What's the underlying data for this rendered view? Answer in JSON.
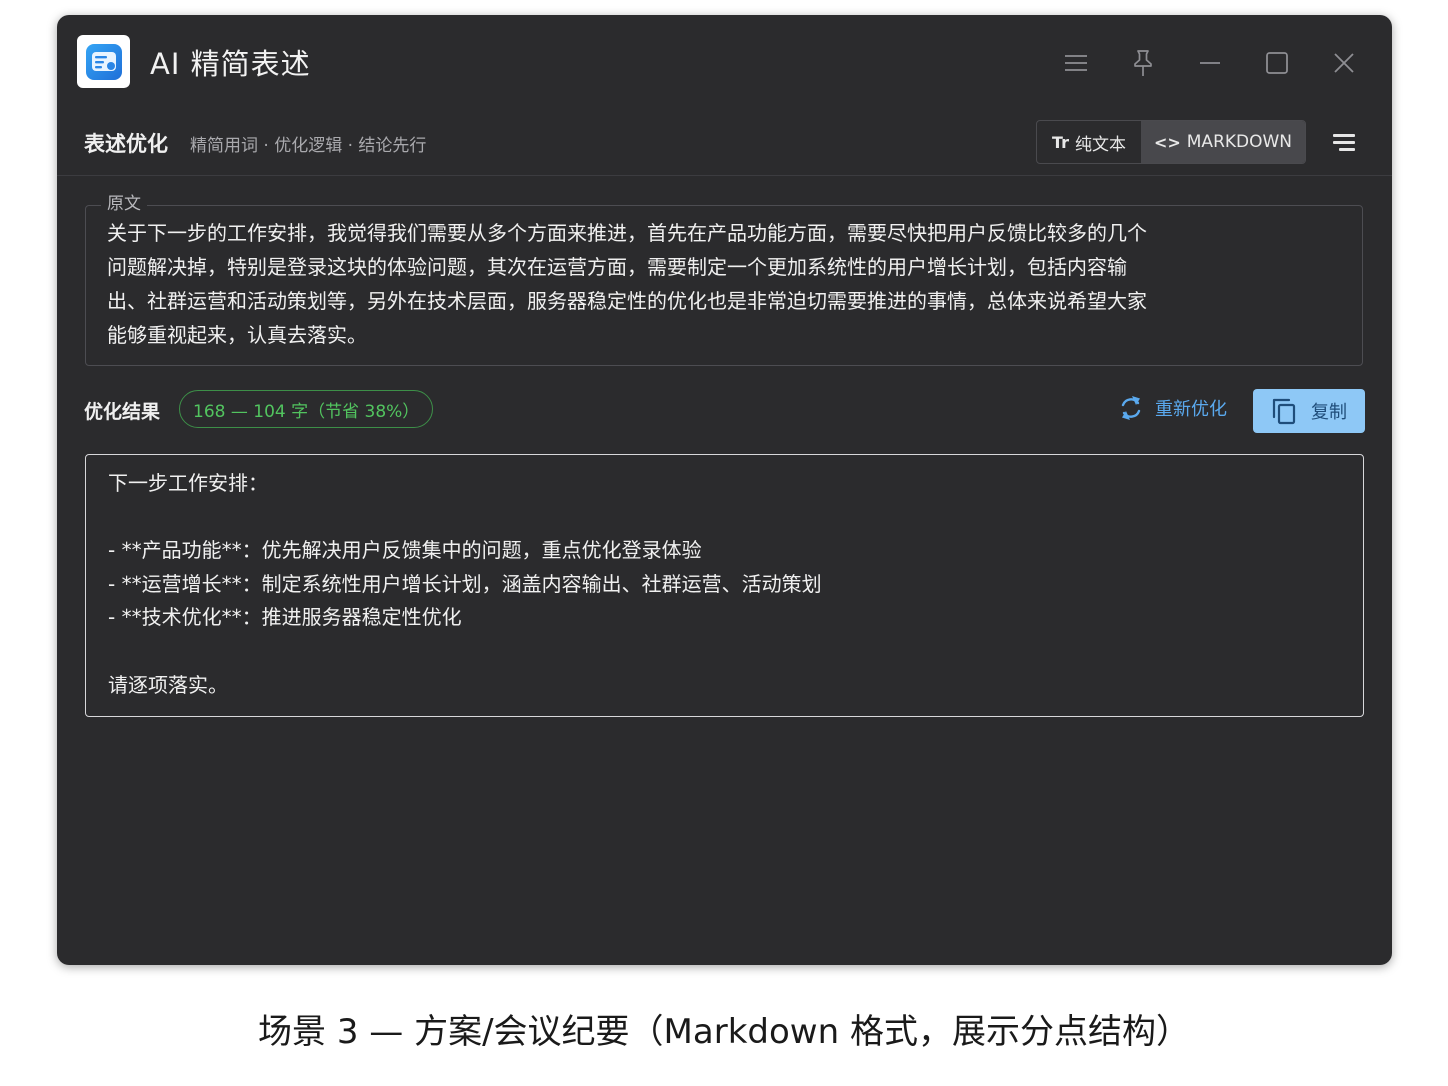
{
  "app": {
    "title": "AI 精简表述",
    "logo_icon": "app-logo-icon"
  },
  "window_controls": {
    "icons": [
      "menu-icon",
      "pin-icon",
      "minimize-icon",
      "maximize-icon",
      "close-icon"
    ]
  },
  "toolbar": {
    "title": "表述优化",
    "subtitle": "精简用词 · 优化逻辑 · 结论先行",
    "mode_plain": {
      "glyph": "Tr",
      "label": "纯文本"
    },
    "mode_markdown": {
      "glyph": "<>",
      "label": "MARKDOWN"
    },
    "active_mode": "markdown"
  },
  "source": {
    "legend": "原文",
    "lines": [
      "关于下一步的工作安排，我觉得我们需要从多个方面来推进，首先在产品功能方面，需要尽快把用户反馈比较多的几个",
      "问题解决掉，特别是登录这块的体验问题，其次在运营方面，需要制定一个更加系统性的用户增长计划，包括内容输",
      "出、社群运营和活动策划等，另外在技术层面，服务器稳定性的优化也是非常迫切需要推进的事情，总体来说希望大家",
      "能够重视起来，认真去落实。"
    ]
  },
  "result": {
    "label": "优化结果",
    "count_badge": "168 — 104 字（节省 38%）",
    "regenerate_label": "重新优化",
    "copy_label": "复制",
    "lines": [
      "下一步工作安排：",
      "",
      "- **产品功能**：优先解决用户反馈集中的问题，重点优化登录体验",
      "- **运营增长**：制定系统性用户增长计划，涵盖内容输出、社群运营、活动策划",
      "- **技术优化**：推进服务器稳定性优化",
      "",
      "请逐项落实。"
    ]
  },
  "caption": "场景 3 — 方案/会议纪要（Markdown 格式，展示分点结构）",
  "colors": {
    "window_bg": "#2b2b2d",
    "accent_blue": "#5aa9ee",
    "copy_button_bg": "#8ec8f6",
    "badge_green": "#52c45f"
  }
}
